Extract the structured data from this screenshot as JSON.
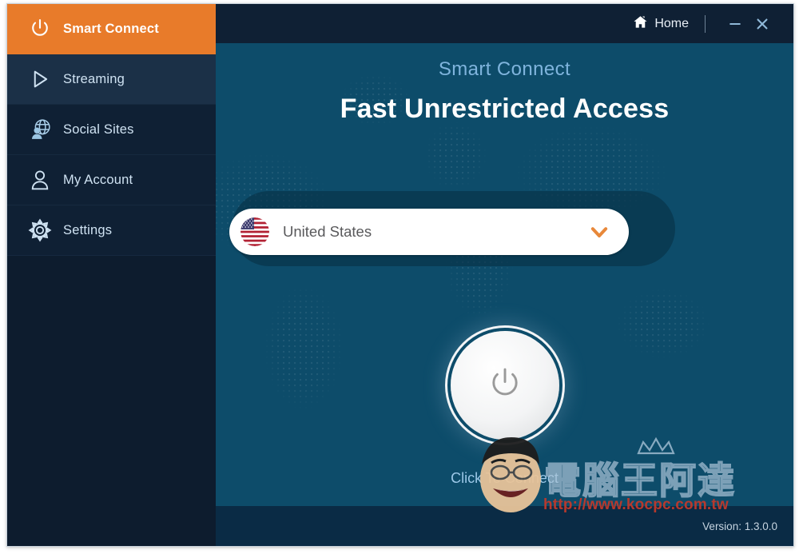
{
  "titlebar": {
    "home_label": "Home",
    "home_icon": "home-icon",
    "minimize_label": "—",
    "close_label": "✕"
  },
  "sidebar": {
    "items": [
      {
        "label": "Smart Connect",
        "icon": "power-icon",
        "state": "active"
      },
      {
        "label": "Streaming",
        "icon": "play-triangle-icon",
        "state": "hover"
      },
      {
        "label": "Social Sites",
        "icon": "globe-person-icon",
        "state": "normal"
      },
      {
        "label": "My Account",
        "icon": "user-icon",
        "state": "normal"
      },
      {
        "label": "Settings",
        "icon": "gear-icon",
        "state": "normal"
      }
    ]
  },
  "main": {
    "subtitle": "Smart Connect",
    "title": "Fast Unrestricted Access",
    "country_select": {
      "value": "United States",
      "flag_icon": "us-flag-icon",
      "chevron_icon": "chevron-down-icon",
      "chevron_color": "#e8883a"
    },
    "connect": {
      "icon": "power-icon",
      "label": "Click To Connect"
    }
  },
  "bottom": {
    "version": "Version: 1.3.0.0"
  },
  "watermark": {
    "brand_cjk": "電腦王阿達",
    "url": "http://www.kocpc.com.tw",
    "mascot_icon": "mascot-face-icon",
    "crown_icon": "crown-icon"
  },
  "colors": {
    "accent_orange": "#e87b2a",
    "sidebar_bg": "#0f2034",
    "main_bg": "#0d4c6a",
    "bottom_bg": "#0a2b45"
  }
}
